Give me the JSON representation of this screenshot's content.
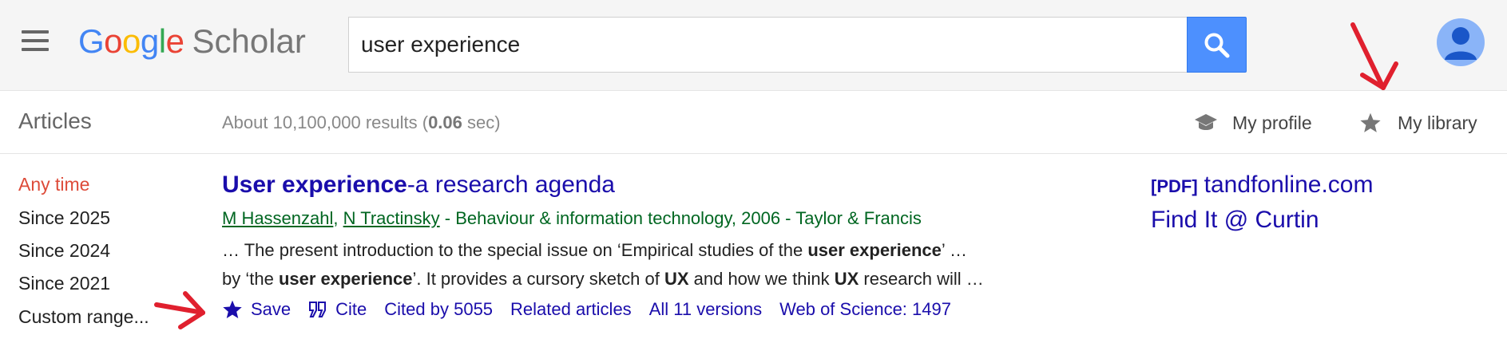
{
  "header": {
    "logo_letters": [
      "G",
      "o",
      "o",
      "g",
      "l",
      "e"
    ],
    "logo_suffix": "Scholar",
    "search_value": "user experience",
    "icons": {
      "menu": "hamburger-menu-icon",
      "search": "magnifier-icon",
      "avatar": "person-avatar-icon"
    },
    "colors": {
      "search_button": "#4d90fe",
      "avatar_bg": "#8ab4f8"
    }
  },
  "subbar": {
    "section_title": "Articles",
    "result_stats_prefix": "About 10,100,000 results (",
    "result_stats_time": "0.06",
    "result_stats_suffix": " sec)",
    "profile_label": "My profile",
    "library_label": "My library"
  },
  "filters": {
    "items": [
      "Any time",
      "Since 2025",
      "Since 2024",
      "Since 2021",
      "Custom range..."
    ],
    "active_color": "#dd4b39"
  },
  "result": {
    "title_bold": "User experience",
    "title_rest": "-a research agenda",
    "author1": "M Hassenzahl",
    "author_sep": ", ",
    "author2": "N Tractinsky",
    "source": " - Behaviour & information technology, 2006 - Taylor & Francis",
    "snippet_line1": [
      {
        "text": "… The present introduction to the special issue on ‘Empirical studies of the ",
        "bold": false
      },
      {
        "text": "user experience",
        "bold": true
      },
      {
        "text": "’ …",
        "bold": false
      }
    ],
    "snippet_line2": [
      {
        "text": "by ‘the ",
        "bold": false
      },
      {
        "text": "user experience",
        "bold": true
      },
      {
        "text": "’. It provides a cursory sketch of ",
        "bold": false
      },
      {
        "text": "UX",
        "bold": true
      },
      {
        "text": " and how we think ",
        "bold": false
      },
      {
        "text": "UX",
        "bold": true
      },
      {
        "text": " research will …",
        "bold": false
      }
    ],
    "actions": {
      "save": "Save",
      "cite": "Cite",
      "cited_by": "Cited by 5055",
      "related": "Related articles",
      "versions": "All 11 versions",
      "wos": "Web of Science: 1497"
    },
    "link_color": "#1a0dab",
    "green_color": "#006621"
  },
  "side_links": {
    "pdf_tag": "[PDF]",
    "pdf_domain": "tandfonline.com",
    "findit": "Find It @ Curtin"
  },
  "annotations": {
    "arrow_color": "#e0202e"
  }
}
